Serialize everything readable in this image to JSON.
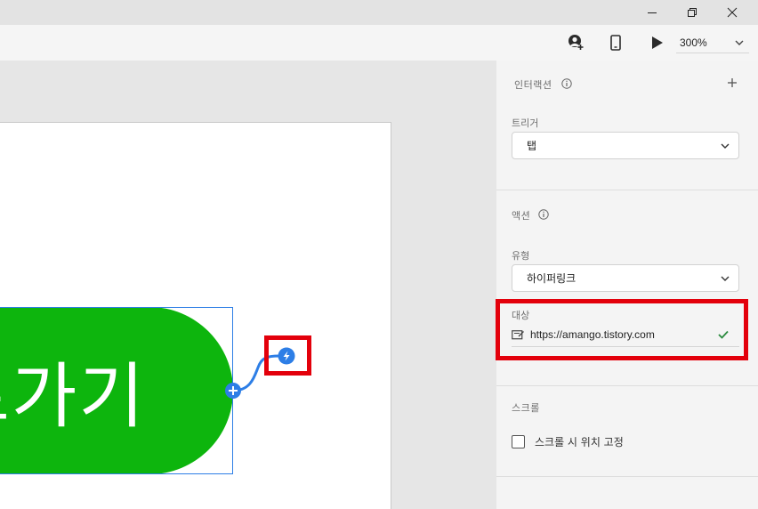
{
  "window": {
    "minimize_icon": "minimize-icon",
    "restore_icon": "restore-icon",
    "close_icon": "close-icon"
  },
  "toolbar": {
    "share_icon": "user-share-icon",
    "device_icon": "mobile-device-icon",
    "play_icon": "play-icon",
    "zoom": "300%"
  },
  "canvas": {
    "button_text": "로가기"
  },
  "panel": {
    "interaction_title": "인터랙션",
    "trigger_label": "트리거",
    "trigger_value": "탭",
    "action_title": "액션",
    "type_label": "유형",
    "type_value": "하이퍼링크",
    "target_label": "대상",
    "target_url": "https://amango.tistory.com",
    "scroll_title": "스크롤",
    "fix_position_label": "스크롤 시 위치 고정",
    "fix_position_checked": false
  },
  "colors": {
    "button_fill": "#0db50d",
    "selection_blue": "#2d7ee6",
    "highlight_red": "#e3000b",
    "check_green": "#2a8a3e"
  }
}
